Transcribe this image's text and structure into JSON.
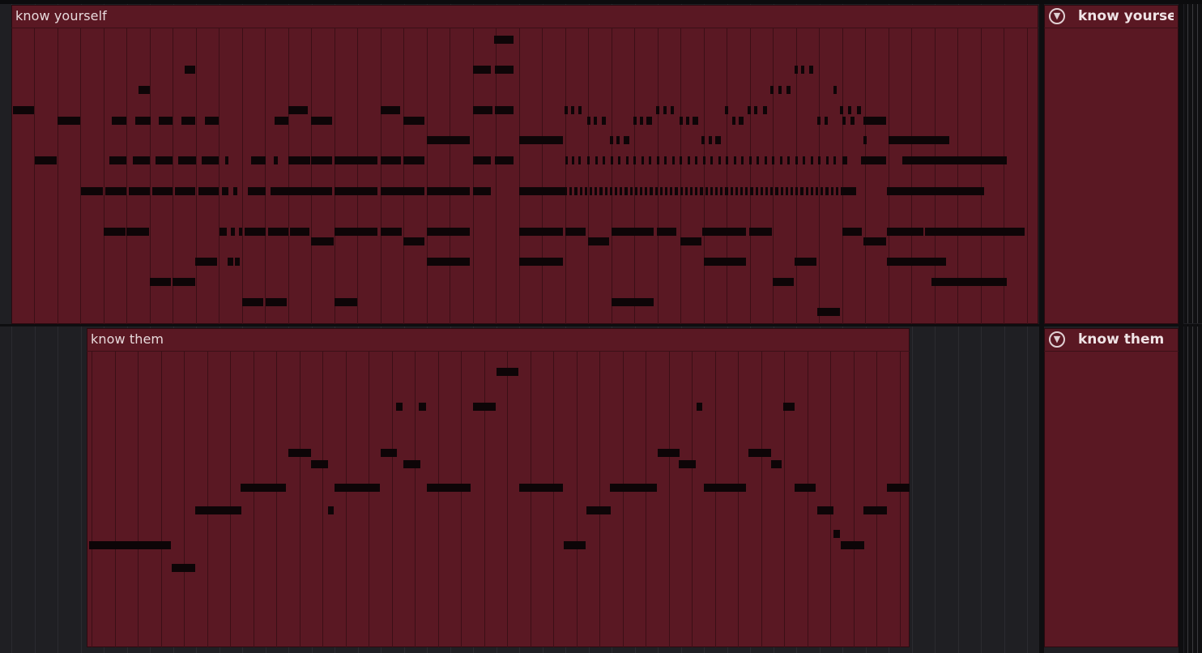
{
  "tracks": [
    {
      "clip_title": "know yourself",
      "panel_title": "know yoursel",
      "panel_icon": "dropdown-circle-icon"
    },
    {
      "clip_title": "know them",
      "panel_title": "know them",
      "panel_icon": "dropdown-circle-icon"
    }
  ],
  "colors": {
    "clip": "#5a1823",
    "note": "#0d0507",
    "background": "#1f1f23"
  }
}
